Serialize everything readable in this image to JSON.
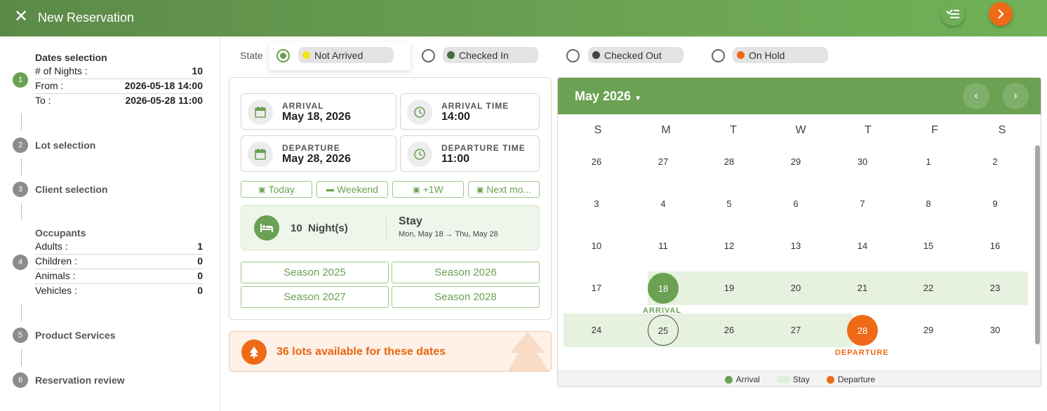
{
  "header": {
    "title": "New Reservation",
    "close_icon": "close-icon",
    "checklist_icon": "checklist-icon",
    "next_icon": "chevron-right-icon"
  },
  "colors": {
    "brand_green": "#6aa152",
    "accent_orange": "#ef6a17",
    "stay_band": "#e6f1e0",
    "not_arrived": "#f4e21c",
    "checked_in": "#4a6b3d",
    "checked_out": "#444444",
    "on_hold": "#ef6a17"
  },
  "steps": {
    "dates": {
      "num": "1",
      "title": "Dates selection",
      "nights_label": "# of Nights :",
      "nights_value": "10",
      "from_label": "From :",
      "from_value": "2026-05-18 14:00",
      "to_label": "To :",
      "to_value": "2026-05-28 11:00"
    },
    "lot": {
      "num": "2",
      "title": "Lot selection"
    },
    "client": {
      "num": "3",
      "title": "Client selection"
    },
    "occupants": {
      "num": "4",
      "title": "Occupants",
      "adults_label": "Adults :",
      "adults_value": "1",
      "children_label": "Children :",
      "children_value": "0",
      "animals_label": "Animals :",
      "animals_value": "0",
      "vehicles_label": "Vehicles :",
      "vehicles_value": "0"
    },
    "products": {
      "num": "5",
      "title": "Product Services"
    },
    "review": {
      "num": "6",
      "title": "Reservation review"
    }
  },
  "state": {
    "label": "State",
    "options": [
      {
        "label": "Not Arrived",
        "selected": true
      },
      {
        "label": "Checked In",
        "selected": false
      },
      {
        "label": "Checked Out",
        "selected": false
      },
      {
        "label": "On Hold",
        "selected": false
      }
    ]
  },
  "fields": {
    "arrival_label": "ARRIVAL",
    "arrival_value": "May 18, 2026",
    "arrival_time_label": "ARRIVAL TIME",
    "arrival_time_value": "14:00",
    "departure_label": "DEPARTURE",
    "departure_value": "May 28, 2026",
    "departure_time_label": "DEPARTURE TIME",
    "departure_time_value": "11:00"
  },
  "quick": {
    "today": "Today",
    "weekend": "Weekend",
    "plus1w": "+1W",
    "next_month": "Next mo..."
  },
  "nights_box": {
    "count": "10",
    "unit": "Night(s)",
    "stay_title": "Stay",
    "stay_range": "Mon, May 18 → Thu, May 28"
  },
  "seasons": [
    "Season 2025",
    "Season 2026",
    "Season 2027",
    "Season 2028"
  ],
  "availability": {
    "text": "36 lots available for these dates"
  },
  "calendar": {
    "month_label": "May 2026",
    "weekdays": [
      "S",
      "M",
      "T",
      "W",
      "T",
      "F",
      "S"
    ],
    "weeks": [
      [
        "26",
        "27",
        "28",
        "29",
        "30",
        "1",
        "2"
      ],
      [
        "3",
        "4",
        "5",
        "6",
        "7",
        "8",
        "9"
      ],
      [
        "10",
        "11",
        "12",
        "13",
        "14",
        "15",
        "16"
      ],
      [
        "17",
        "18",
        "19",
        "20",
        "21",
        "22",
        "23"
      ],
      [
        "24",
        "25",
        "26",
        "27",
        "28",
        "29",
        "30"
      ]
    ],
    "arrival_tag": "ARRIVAL",
    "departure_tag": "DEPARTURE",
    "legend": {
      "arrival": "Arrival",
      "stay": "Stay",
      "departure": "Departure"
    }
  }
}
